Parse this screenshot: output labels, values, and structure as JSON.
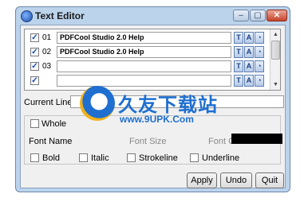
{
  "window": {
    "title": "Text Editor",
    "controls": {
      "minimize": "–",
      "maximize": "▢",
      "close": "✕"
    }
  },
  "lines": [
    {
      "checked": true,
      "number": "01",
      "text": "PDFCool Studio 2.0 Help"
    },
    {
      "checked": true,
      "number": "02",
      "text": "PDFCool Studio 2.0 Help"
    },
    {
      "checked": true,
      "number": "03",
      "text": ""
    }
  ],
  "format_buttons": {
    "text": "T",
    "font": "A",
    "color": "◔"
  },
  "scrollbar": {
    "up": "▲",
    "down": "▼"
  },
  "current_line": {
    "label": "Current Line",
    "value": ""
  },
  "whole": {
    "label": "Whole",
    "checked": false
  },
  "font": {
    "name_label": "Font Name",
    "size_label": "Font Size",
    "color_label": "Font Co",
    "color_value": "#000000"
  },
  "style_options": [
    {
      "label": "Bold",
      "checked": false
    },
    {
      "label": "Italic",
      "checked": false
    },
    {
      "label": "Strokeline",
      "checked": false
    },
    {
      "label": "Underline",
      "checked": false
    }
  ],
  "buttons": {
    "apply": "Apply",
    "undo": "Undo",
    "quit": "Quit"
  },
  "watermark": {
    "name": "久友下载站",
    "url": "www.9UPK.Com"
  }
}
